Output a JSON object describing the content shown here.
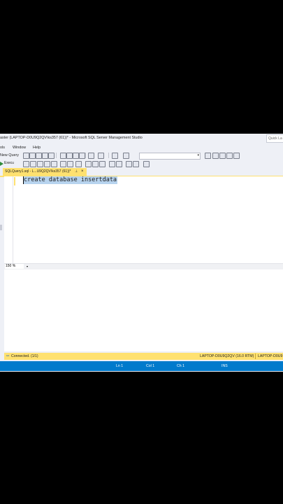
{
  "window": {
    "title": "aster (LAPTOP-D0U9Q2QV\\ks357 (61))* - Microsoft SQL Server Management Studio",
    "quick_launch": "Quick La"
  },
  "menu": {
    "items": [
      "ols",
      "Window",
      "Help"
    ]
  },
  "toolbar": {
    "new_query": "New Query",
    "execute": "Execu"
  },
  "tab": {
    "label": "SQLQuery1.sql - L...U9Q2QV\\ks357 (61))*",
    "pin": "⊥",
    "close": "×"
  },
  "editor": {
    "code": "create database insertdata",
    "zoom": "150 %"
  },
  "query_status": {
    "connected": "Connected. (1/1)",
    "server": "LAPTOP-D0U9Q2QV (16.0 RTM)",
    "server_short": "LAPTOP-D0U9"
  },
  "status": {
    "ln": "Ln 1",
    "col": "Col 1",
    "ch": "Ch 1",
    "mode": "INS"
  },
  "colors": {
    "accent": "#007acc",
    "tab": "#ffe170",
    "selection": "#b7d3ee"
  }
}
